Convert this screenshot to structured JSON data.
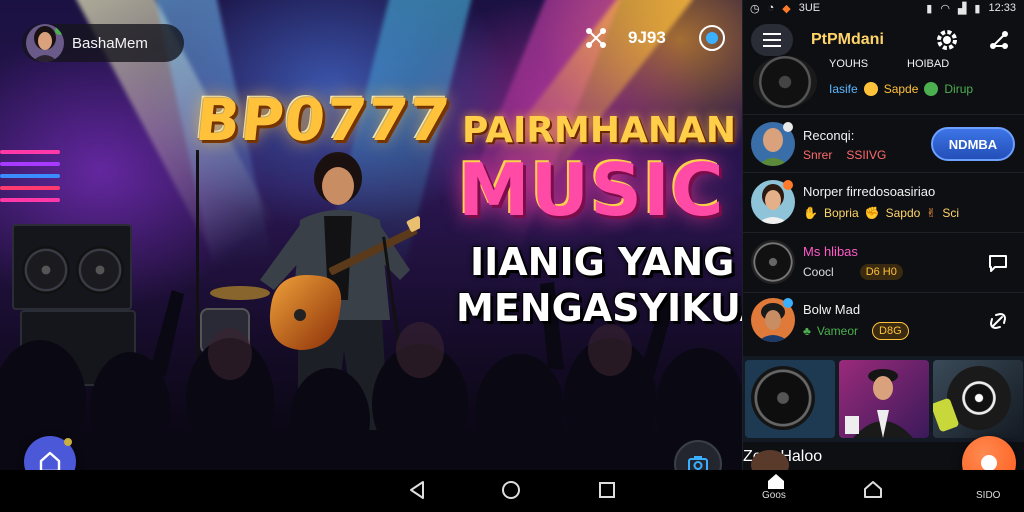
{
  "status_bar": {
    "left_icons": [
      "alarm-icon",
      "sync-icon",
      "game-icon",
      "gamepad-icon"
    ],
    "left_text": "3UE",
    "right_icons": [
      "vibrate-icon",
      "wifi-icon",
      "signal-icon",
      "battery-icon"
    ],
    "time": "12:33"
  },
  "user": {
    "name": "BashaMem",
    "badge_color": "#4caf50"
  },
  "stage": {
    "viewer_count": "9J93",
    "title_brand": "BP0777",
    "title_sub": "PAIRMHANAN",
    "title_main": "MUSIC",
    "title_line1": "IIANIG YANG",
    "title_line2": "MENGASYIKUAN"
  },
  "panel": {
    "title": "PtPMdani",
    "rows": [
      {
        "name": "YOUHS",
        "sub_name": "HOIBAD",
        "tags": [
          "Iasife",
          "Sapde",
          "Dirup"
        ]
      },
      {
        "name": "Reconqi:",
        "sub": [
          "Snrer",
          "SSIIVG"
        ],
        "action": "NDMBA"
      },
      {
        "name": "Norper firredosoasiriao",
        "tags": [
          "Bopria",
          "Sapdo",
          "Sci"
        ]
      },
      {
        "name": "Ms hlibas",
        "sub": [
          "Coocl",
          "D6 H0"
        ]
      },
      {
        "name": "Bolw Mad",
        "sub": [
          "Vameor",
          "D8G"
        ]
      }
    ],
    "last_row": "Zero Haloo"
  },
  "navbar": {
    "left_label": "Goos",
    "right_label": "SIDO"
  },
  "colors": {
    "accent": "#ffd56a",
    "brand_blue": "#4b58d8",
    "fab_orange": "#ff5a1a"
  }
}
